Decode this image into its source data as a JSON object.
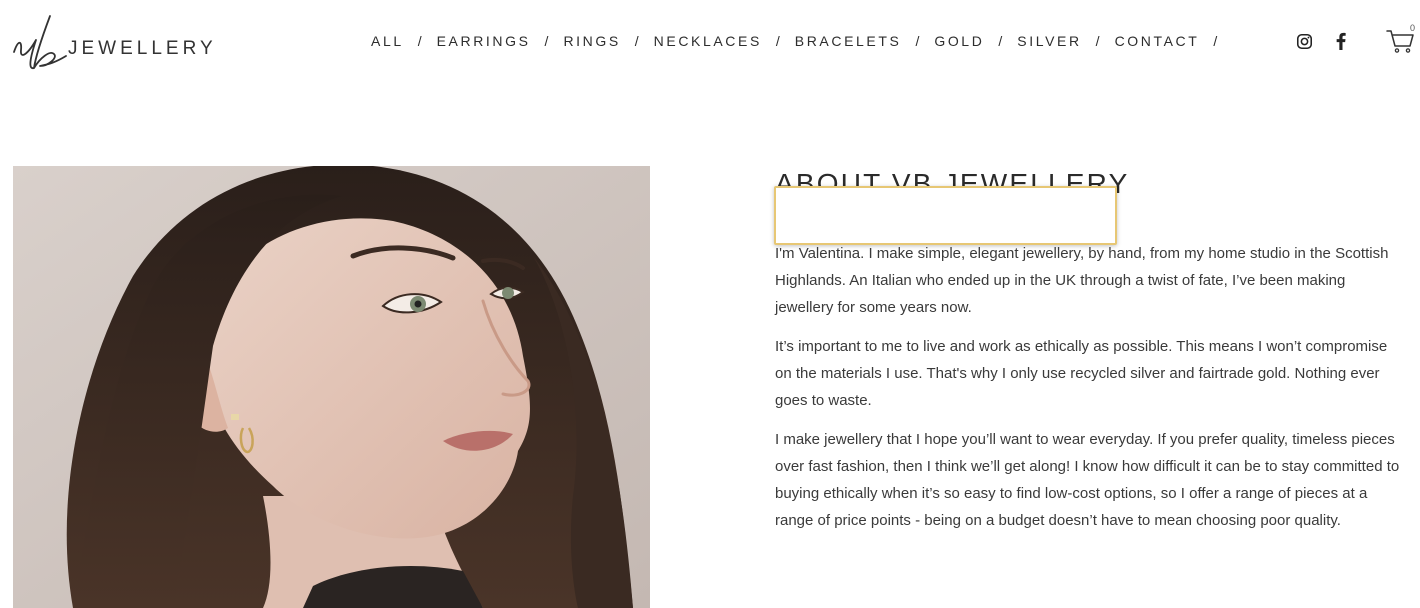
{
  "brand": {
    "monogram": "vb",
    "wordmark": "JEWELLERY"
  },
  "nav": {
    "items": [
      "ALL",
      "EARRINGS",
      "RINGS",
      "NECKLACES",
      "BRACELETS",
      "GOLD",
      "SILVER",
      "CONTACT"
    ],
    "separator": "/"
  },
  "social": {
    "instagram_icon": "instagram-icon",
    "facebook_icon": "facebook-icon"
  },
  "cart": {
    "icon": "cart-icon",
    "count": "0"
  },
  "about": {
    "title": "ABOUT VB JEWELLERY",
    "paragraphs": [
      "I'm Valentina. I make simple, elegant jewellery, by hand, from my home studio in the Scottish Highlands. An Italian who ended up in the UK through a twist of fate, I’ve been making jewellery for some years now.",
      "It’s important to me to live and work as ethically as possible. This means I won’t compromise on the materials I use. That's why I only use recycled silver and fairtrade gold. Nothing ever goes to waste.",
      "I make jewellery that I hope you’ll want to wear everyday. If you prefer quality, timeless pieces over fast fashion, then I think we’ll get along! I know how difficult it can be to stay committed to buying ethically when it’s so easy to find low-cost options, so I offer a range of pieces at a range of price points - being on a budget doesn’t have to mean choosing poor quality."
    ]
  },
  "colors": {
    "text": "#2d2d2d",
    "highlight_border": "#e7c774",
    "photo_background": "#cfc5bf"
  }
}
